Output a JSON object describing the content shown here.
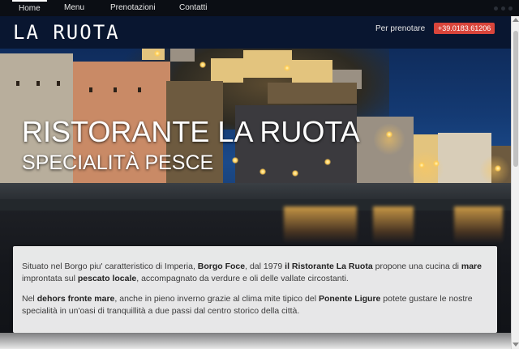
{
  "nav": {
    "items": [
      {
        "label": "Home"
      },
      {
        "label": "Menu"
      },
      {
        "label": "Prenotazioni"
      },
      {
        "label": "Contatti"
      }
    ],
    "active_index": 0
  },
  "header": {
    "logo": "LA RUOTA",
    "reserve_label": "Per prenotare",
    "phone": "+39.0183.61206"
  },
  "hero": {
    "title": "RISTORANTE LA RUOTA",
    "subtitle": "SPECIALITÀ PESCE"
  },
  "intro": {
    "p1": [
      {
        "t": "Situato nel Borgo piu' caratteristico di Imperia, ",
        "b": false
      },
      {
        "t": "Borgo Foce",
        "b": true
      },
      {
        "t": ", dal 1979 ",
        "b": false
      },
      {
        "t": "il Ristorante La Ruota",
        "b": true
      },
      {
        "t": " propone una cucina di ",
        "b": false
      },
      {
        "t": "mare",
        "b": true
      },
      {
        "t": " improntata sul ",
        "b": false
      },
      {
        "t": "pescato locale",
        "b": true
      },
      {
        "t": ", accompagnato da verdure e oli delle vallate circostanti.",
        "b": false
      }
    ],
    "p2": [
      {
        "t": "Nel ",
        "b": false
      },
      {
        "t": "dehors fronte mare",
        "b": true
      },
      {
        "t": ", anche in pieno inverno grazie al clima mite tipico del ",
        "b": false
      },
      {
        "t": "Ponente Ligure",
        "b": true
      },
      {
        "t": " potete gustare le nostre ",
        "b": false
      },
      {
        "t": "specialità in un'oasi di tranquillità a due passi dal centro storico della città.",
        "b": false
      }
    ]
  },
  "colors": {
    "phone_badge": "#d9453b",
    "header_bg": "#0a1630",
    "nav_bg": "#0b0e14"
  }
}
